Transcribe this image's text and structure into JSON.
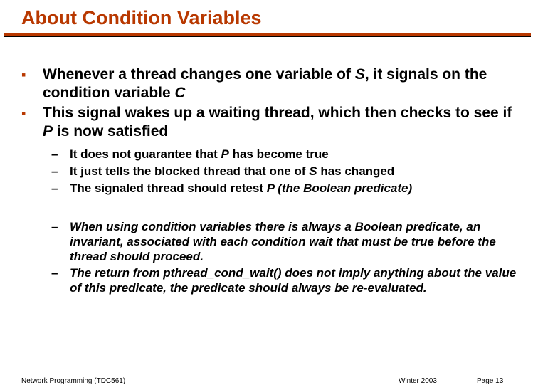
{
  "title": "About Condition Variables",
  "bullets": [
    {
      "html": "Whenever a thread changes one variable of <em>S</em>, it signals on the condition variable <em>C</em>"
    },
    {
      "html": "This signal wakes up a waiting thread, which then checks to see if <em>P</em> is now satisfied"
    }
  ],
  "sub1": [
    {
      "html": "It does not guarantee that <em>P</em> has become true"
    },
    {
      "html": "It just tells the blocked thread that one of <em>S</em> has changed"
    },
    {
      "html": "The signaled thread should retest <em>P (the Boolean predicate)</em>"
    }
  ],
  "sub2": [
    {
      "html": "<em>When using condition variables there is always a Boolean predicate,  an invariant,  associated with each condition wait that must be true before the thread should proceed.</em>"
    },
    {
      "html": "<em>The return from  pthread_cond_wait() does not imply anything about the value of this predicate, the predicate should always be re-evaluated.</em>"
    }
  ],
  "footer": {
    "left": "Network Programming (TDC561)",
    "mid": "Winter  2003",
    "right": "Page 13"
  }
}
